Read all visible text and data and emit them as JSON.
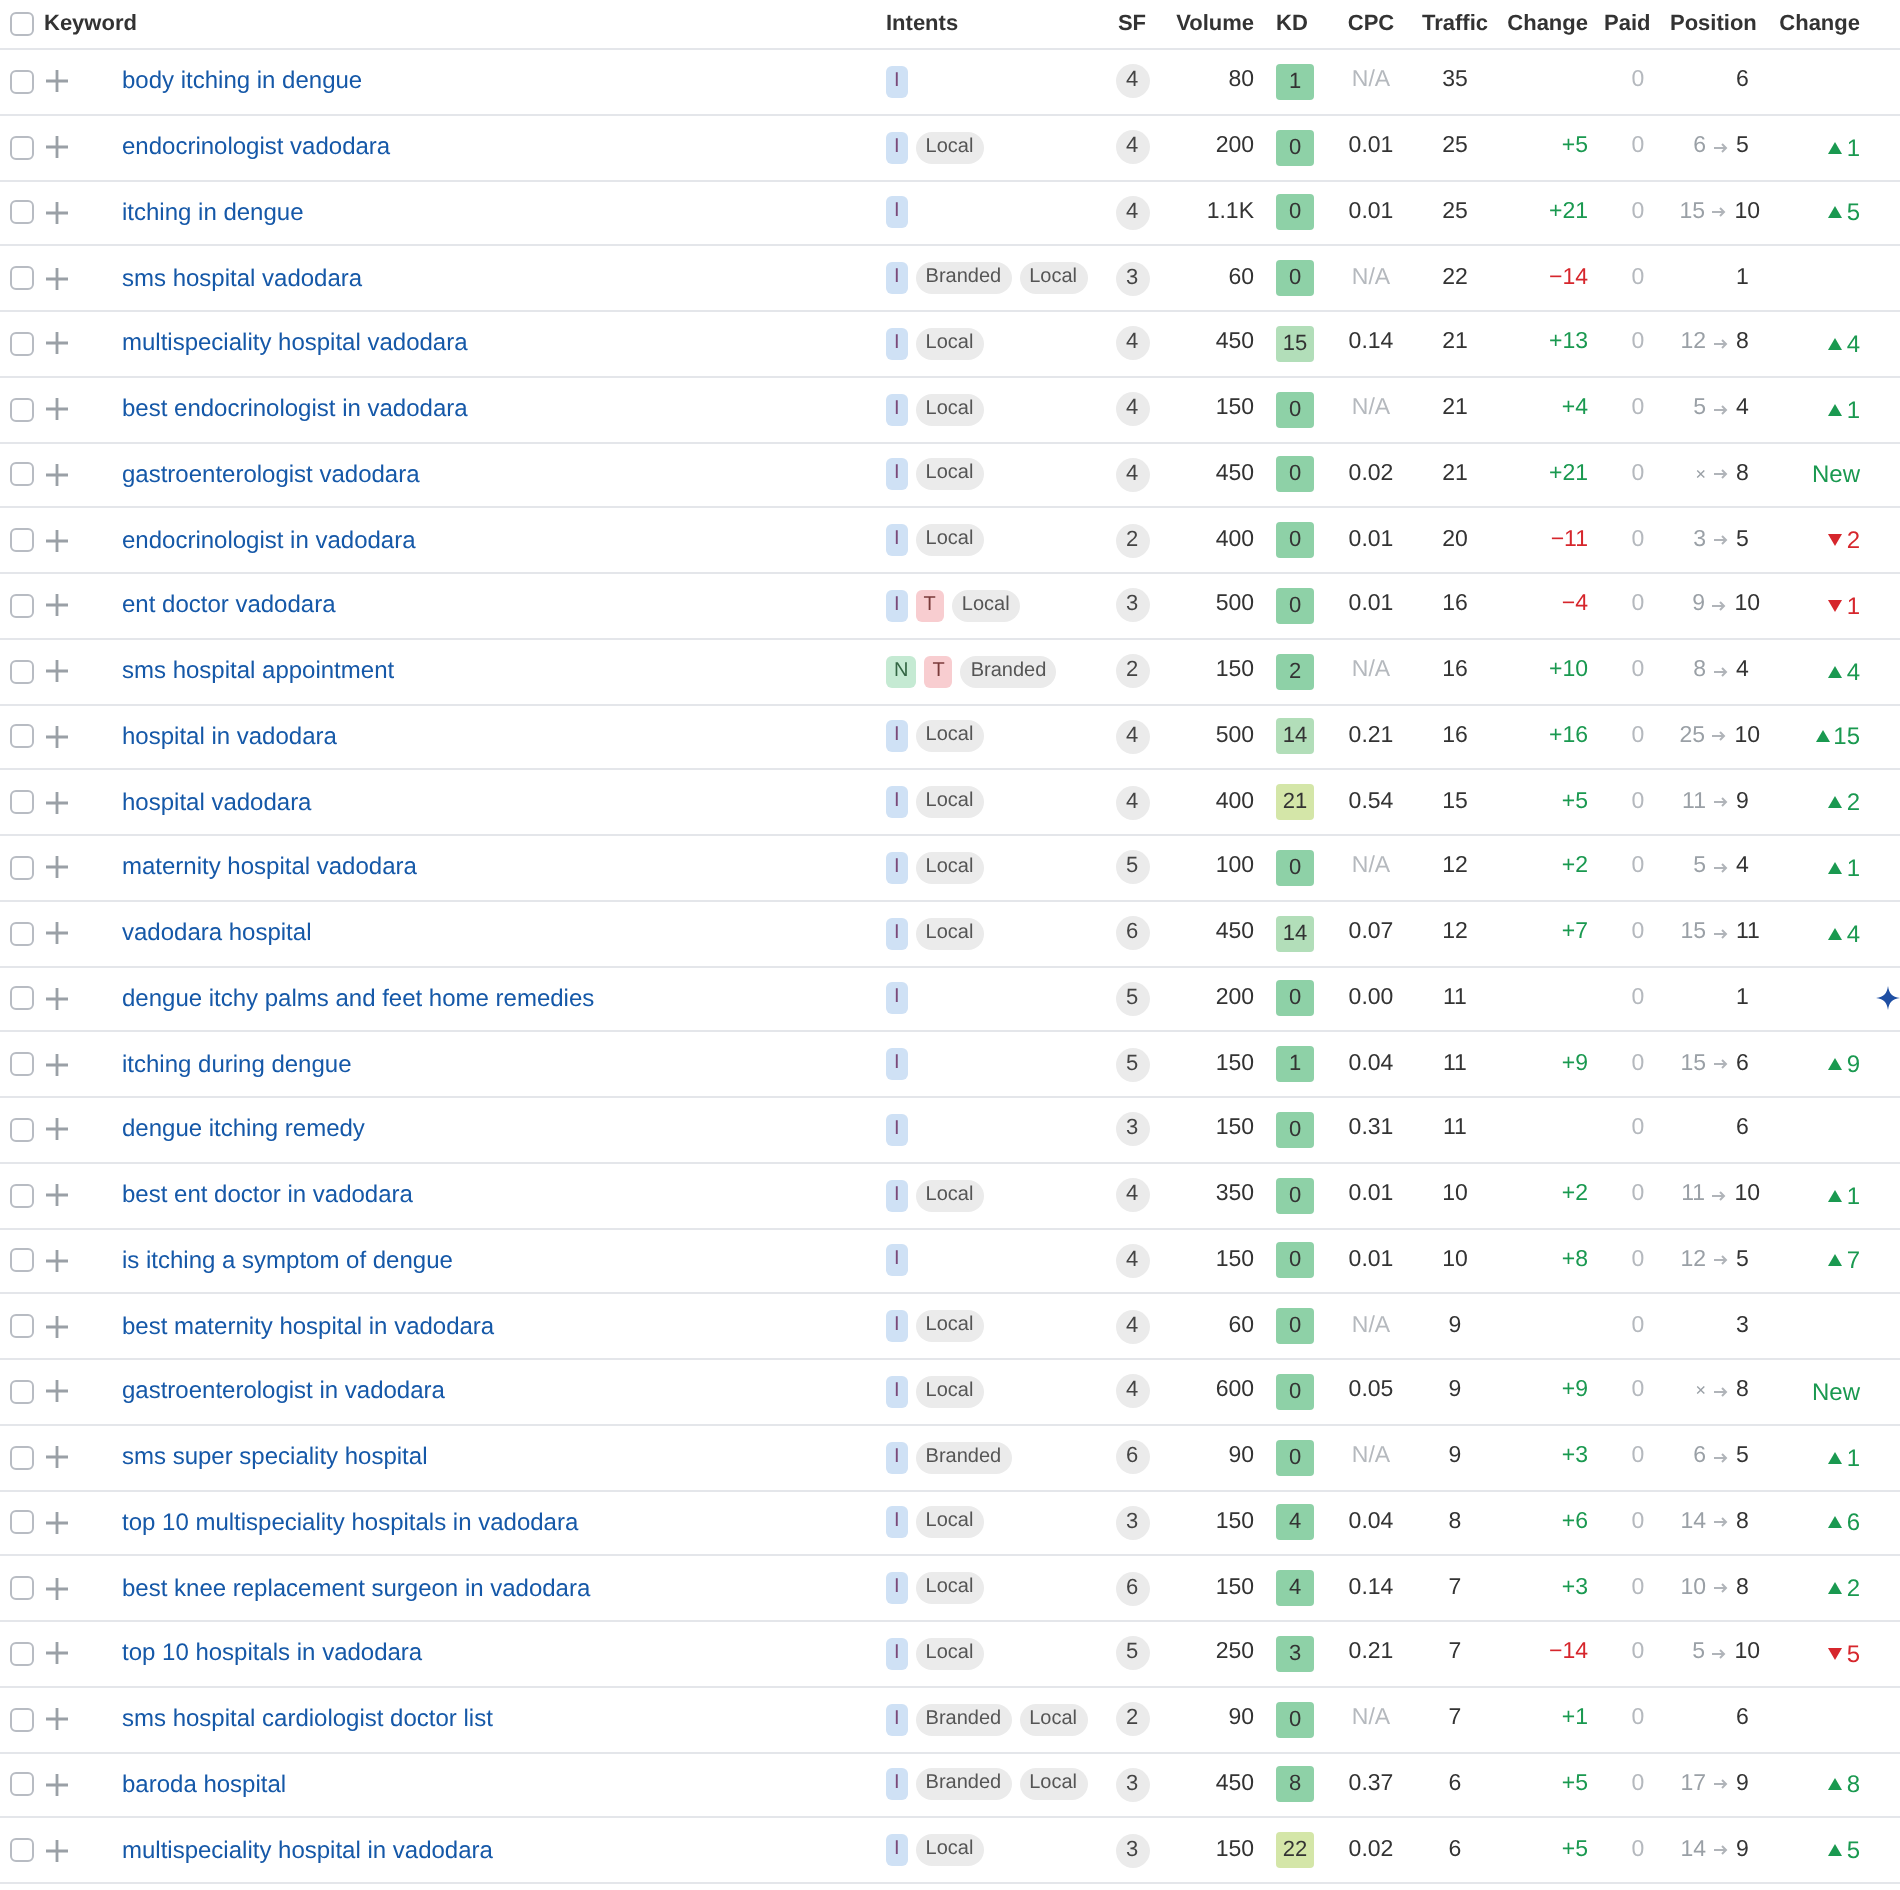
{
  "table": {
    "columns": [
      "Keyword",
      "Intents",
      "SF",
      "Volume",
      "KD",
      "CPC",
      "Traffic",
      "Change",
      "Paid",
      "Position",
      "Change"
    ],
    "all_selected": false,
    "rows": [
      {
        "keyword": "body itching in dengue",
        "selected": false,
        "intents": [
          {
            "label": "I",
            "kind": "informational"
          }
        ],
        "sf": "4",
        "volume": "80",
        "kd": {
          "value": "1",
          "color": "#8ed1a7"
        },
        "cpc": {
          "text": "N/A",
          "muted": true
        },
        "traffic": "35",
        "paid": "0",
        "position": {
          "to": "6"
        }
      },
      {
        "keyword": "endocrinologist vadodara",
        "selected": false,
        "intents": [
          {
            "label": "I",
            "kind": "informational"
          },
          {
            "label": "Local",
            "kind": "tag"
          }
        ],
        "sf": "4",
        "volume": "200",
        "kd": {
          "value": "0",
          "color": "#8ed1a7"
        },
        "cpc": {
          "text": "0.01",
          "muted": false
        },
        "traffic": "25",
        "traffic_change": {
          "text": "+5",
          "kind": "up"
        },
        "paid": "0",
        "position": {
          "from": "6",
          "to": "5"
        },
        "position_change": {
          "text": "1",
          "kind": "up"
        }
      },
      {
        "keyword": "itching in dengue",
        "selected": false,
        "intents": [
          {
            "label": "I",
            "kind": "informational"
          }
        ],
        "sf": "4",
        "volume": "1.1K",
        "kd": {
          "value": "0",
          "color": "#8ed1a7"
        },
        "cpc": {
          "text": "0.01",
          "muted": false
        },
        "traffic": "25",
        "traffic_change": {
          "text": "+21",
          "kind": "up"
        },
        "paid": "0",
        "position": {
          "from": "15",
          "to": "10"
        },
        "position_change": {
          "text": "5",
          "kind": "up"
        }
      },
      {
        "keyword": "sms hospital vadodara",
        "selected": false,
        "intents": [
          {
            "label": "I",
            "kind": "informational"
          },
          {
            "label": "Branded",
            "kind": "tag"
          },
          {
            "label": "Local",
            "kind": "tag"
          }
        ],
        "sf": "3",
        "volume": "60",
        "kd": {
          "value": "0",
          "color": "#8ed1a7"
        },
        "cpc": {
          "text": "N/A",
          "muted": true
        },
        "traffic": "22",
        "traffic_change": {
          "text": "−14",
          "kind": "down"
        },
        "paid": "0",
        "position": {
          "to": "1"
        }
      },
      {
        "keyword": "multispeciality hospital vadodara",
        "selected": false,
        "intents": [
          {
            "label": "I",
            "kind": "informational"
          },
          {
            "label": "Local",
            "kind": "tag"
          }
        ],
        "sf": "4",
        "volume": "450",
        "kd": {
          "value": "15",
          "color": "#b2deb9"
        },
        "cpc": {
          "text": "0.14",
          "muted": false
        },
        "traffic": "21",
        "traffic_change": {
          "text": "+13",
          "kind": "up"
        },
        "paid": "0",
        "position": {
          "from": "12",
          "to": "8"
        },
        "position_change": {
          "text": "4",
          "kind": "up"
        }
      },
      {
        "keyword": "best endocrinologist in vadodara",
        "selected": false,
        "intents": [
          {
            "label": "I",
            "kind": "informational"
          },
          {
            "label": "Local",
            "kind": "tag"
          }
        ],
        "sf": "4",
        "volume": "150",
        "kd": {
          "value": "0",
          "color": "#8ed1a7"
        },
        "cpc": {
          "text": "N/A",
          "muted": true
        },
        "traffic": "21",
        "traffic_change": {
          "text": "+4",
          "kind": "up"
        },
        "paid": "0",
        "position": {
          "from": "5",
          "to": "4"
        },
        "position_change": {
          "text": "1",
          "kind": "up"
        }
      },
      {
        "keyword": "gastroenterologist vadodara",
        "selected": false,
        "intents": [
          {
            "label": "I",
            "kind": "informational"
          },
          {
            "label": "Local",
            "kind": "tag"
          }
        ],
        "sf": "4",
        "volume": "450",
        "kd": {
          "value": "0",
          "color": "#8ed1a7"
        },
        "cpc": {
          "text": "0.02",
          "muted": false
        },
        "traffic": "21",
        "traffic_change": {
          "text": "+21",
          "kind": "up"
        },
        "paid": "0",
        "position": {
          "from": "×",
          "to": "8"
        },
        "position_change": {
          "text": "New",
          "kind": "new"
        }
      },
      {
        "keyword": "endocrinologist in vadodara",
        "selected": false,
        "intents": [
          {
            "label": "I",
            "kind": "informational"
          },
          {
            "label": "Local",
            "kind": "tag"
          }
        ],
        "sf": "2",
        "volume": "400",
        "kd": {
          "value": "0",
          "color": "#8ed1a7"
        },
        "cpc": {
          "text": "0.01",
          "muted": false
        },
        "traffic": "20",
        "traffic_change": {
          "text": "−11",
          "kind": "down"
        },
        "paid": "0",
        "position": {
          "from": "3",
          "to": "5"
        },
        "position_change": {
          "text": "2",
          "kind": "down"
        }
      },
      {
        "keyword": "ent doctor vadodara",
        "selected": false,
        "intents": [
          {
            "label": "I",
            "kind": "informational"
          },
          {
            "label": "T",
            "kind": "transactional"
          },
          {
            "label": "Local",
            "kind": "tag"
          }
        ],
        "sf": "3",
        "volume": "500",
        "kd": {
          "value": "0",
          "color": "#8ed1a7"
        },
        "cpc": {
          "text": "0.01",
          "muted": false
        },
        "traffic": "16",
        "traffic_change": {
          "text": "−4",
          "kind": "down"
        },
        "paid": "0",
        "position": {
          "from": "9",
          "to": "10"
        },
        "position_change": {
          "text": "1",
          "kind": "down"
        }
      },
      {
        "keyword": "sms hospital appointment",
        "selected": false,
        "intents": [
          {
            "label": "N",
            "kind": "navigational"
          },
          {
            "label": "T",
            "kind": "transactional"
          },
          {
            "label": "Branded",
            "kind": "tag"
          }
        ],
        "sf": "2",
        "volume": "150",
        "kd": {
          "value": "2",
          "color": "#8ed1a7"
        },
        "cpc": {
          "text": "N/A",
          "muted": true
        },
        "traffic": "16",
        "traffic_change": {
          "text": "+10",
          "kind": "up"
        },
        "paid": "0",
        "position": {
          "from": "8",
          "to": "4"
        },
        "position_change": {
          "text": "4",
          "kind": "up"
        }
      },
      {
        "keyword": "hospital in vadodara",
        "selected": false,
        "intents": [
          {
            "label": "I",
            "kind": "informational"
          },
          {
            "label": "Local",
            "kind": "tag"
          }
        ],
        "sf": "4",
        "volume": "500",
        "kd": {
          "value": "14",
          "color": "#b2deb9"
        },
        "cpc": {
          "text": "0.21",
          "muted": false
        },
        "traffic": "16",
        "traffic_change": {
          "text": "+16",
          "kind": "up"
        },
        "paid": "0",
        "position": {
          "from": "25",
          "to": "10"
        },
        "position_change": {
          "text": "15",
          "kind": "up"
        }
      },
      {
        "keyword": "hospital vadodara",
        "selected": false,
        "intents": [
          {
            "label": "I",
            "kind": "informational"
          },
          {
            "label": "Local",
            "kind": "tag"
          }
        ],
        "sf": "4",
        "volume": "400",
        "kd": {
          "value": "21",
          "color": "#d4e6a8"
        },
        "cpc": {
          "text": "0.54",
          "muted": false
        },
        "traffic": "15",
        "traffic_change": {
          "text": "+5",
          "kind": "up"
        },
        "paid": "0",
        "position": {
          "from": "11",
          "to": "9"
        },
        "position_change": {
          "text": "2",
          "kind": "up"
        }
      },
      {
        "keyword": "maternity hospital vadodara",
        "selected": false,
        "intents": [
          {
            "label": "I",
            "kind": "informational"
          },
          {
            "label": "Local",
            "kind": "tag"
          }
        ],
        "sf": "5",
        "volume": "100",
        "kd": {
          "value": "0",
          "color": "#8ed1a7"
        },
        "cpc": {
          "text": "N/A",
          "muted": true
        },
        "traffic": "12",
        "traffic_change": {
          "text": "+2",
          "kind": "up"
        },
        "paid": "0",
        "position": {
          "from": "5",
          "to": "4"
        },
        "position_change": {
          "text": "1",
          "kind": "up"
        }
      },
      {
        "keyword": "vadodara hospital",
        "selected": false,
        "intents": [
          {
            "label": "I",
            "kind": "informational"
          },
          {
            "label": "Local",
            "kind": "tag"
          }
        ],
        "sf": "6",
        "volume": "450",
        "kd": {
          "value": "14",
          "color": "#b2deb9"
        },
        "cpc": {
          "text": "0.07",
          "muted": false
        },
        "traffic": "12",
        "traffic_change": {
          "text": "+7",
          "kind": "up"
        },
        "paid": "0",
        "position": {
          "from": "15",
          "to": "11"
        },
        "position_change": {
          "text": "4",
          "kind": "up"
        }
      },
      {
        "keyword": "dengue itchy palms and feet home remedies",
        "selected": false,
        "intents": [
          {
            "label": "I",
            "kind": "informational"
          }
        ],
        "sf": "5",
        "volume": "200",
        "kd": {
          "value": "0",
          "color": "#8ed1a7"
        },
        "cpc": {
          "text": "0.00",
          "muted": false
        },
        "traffic": "11",
        "paid": "0",
        "position": {
          "to": "1"
        },
        "feature": true
      },
      {
        "keyword": "itching during dengue",
        "selected": false,
        "intents": [
          {
            "label": "I",
            "kind": "informational"
          }
        ],
        "sf": "5",
        "volume": "150",
        "kd": {
          "value": "1",
          "color": "#8ed1a7"
        },
        "cpc": {
          "text": "0.04",
          "muted": false
        },
        "traffic": "11",
        "traffic_change": {
          "text": "+9",
          "kind": "up"
        },
        "paid": "0",
        "position": {
          "from": "15",
          "to": "6"
        },
        "position_change": {
          "text": "9",
          "kind": "up"
        }
      },
      {
        "keyword": "dengue itching remedy",
        "selected": false,
        "intents": [
          {
            "label": "I",
            "kind": "informational"
          }
        ],
        "sf": "3",
        "volume": "150",
        "kd": {
          "value": "0",
          "color": "#8ed1a7"
        },
        "cpc": {
          "text": "0.31",
          "muted": false
        },
        "traffic": "11",
        "paid": "0",
        "position": {
          "to": "6"
        }
      },
      {
        "keyword": "best ent doctor in vadodara",
        "selected": false,
        "intents": [
          {
            "label": "I",
            "kind": "informational"
          },
          {
            "label": "Local",
            "kind": "tag"
          }
        ],
        "sf": "4",
        "volume": "350",
        "kd": {
          "value": "0",
          "color": "#8ed1a7"
        },
        "cpc": {
          "text": "0.01",
          "muted": false
        },
        "traffic": "10",
        "traffic_change": {
          "text": "+2",
          "kind": "up"
        },
        "paid": "0",
        "position": {
          "from": "11",
          "to": "10"
        },
        "position_change": {
          "text": "1",
          "kind": "up"
        }
      },
      {
        "keyword": "is itching a symptom of dengue",
        "selected": false,
        "intents": [
          {
            "label": "I",
            "kind": "informational"
          }
        ],
        "sf": "4",
        "volume": "150",
        "kd": {
          "value": "0",
          "color": "#8ed1a7"
        },
        "cpc": {
          "text": "0.01",
          "muted": false
        },
        "traffic": "10",
        "traffic_change": {
          "text": "+8",
          "kind": "up"
        },
        "paid": "0",
        "position": {
          "from": "12",
          "to": "5"
        },
        "position_change": {
          "text": "7",
          "kind": "up"
        }
      },
      {
        "keyword": "best maternity hospital in vadodara",
        "selected": false,
        "intents": [
          {
            "label": "I",
            "kind": "informational"
          },
          {
            "label": "Local",
            "kind": "tag"
          }
        ],
        "sf": "4",
        "volume": "60",
        "kd": {
          "value": "0",
          "color": "#8ed1a7"
        },
        "cpc": {
          "text": "N/A",
          "muted": true
        },
        "traffic": "9",
        "paid": "0",
        "position": {
          "to": "3"
        }
      },
      {
        "keyword": "gastroenterologist in vadodara",
        "selected": false,
        "intents": [
          {
            "label": "I",
            "kind": "informational"
          },
          {
            "label": "Local",
            "kind": "tag"
          }
        ],
        "sf": "4",
        "volume": "600",
        "kd": {
          "value": "0",
          "color": "#8ed1a7"
        },
        "cpc": {
          "text": "0.05",
          "muted": false
        },
        "traffic": "9",
        "traffic_change": {
          "text": "+9",
          "kind": "up"
        },
        "paid": "0",
        "position": {
          "from": "×",
          "to": "8"
        },
        "position_change": {
          "text": "New",
          "kind": "new"
        }
      },
      {
        "keyword": "sms super speciality hospital",
        "selected": false,
        "intents": [
          {
            "label": "I",
            "kind": "informational"
          },
          {
            "label": "Branded",
            "kind": "tag"
          }
        ],
        "sf": "6",
        "volume": "90",
        "kd": {
          "value": "0",
          "color": "#8ed1a7"
        },
        "cpc": {
          "text": "N/A",
          "muted": true
        },
        "traffic": "9",
        "traffic_change": {
          "text": "+3",
          "kind": "up"
        },
        "paid": "0",
        "position": {
          "from": "6",
          "to": "5"
        },
        "position_change": {
          "text": "1",
          "kind": "up"
        }
      },
      {
        "keyword": "top 10 multispeciality hospitals in vadodara",
        "selected": false,
        "intents": [
          {
            "label": "I",
            "kind": "informational"
          },
          {
            "label": "Local",
            "kind": "tag"
          }
        ],
        "sf": "3",
        "volume": "150",
        "kd": {
          "value": "4",
          "color": "#8ed1a7"
        },
        "cpc": {
          "text": "0.04",
          "muted": false
        },
        "traffic": "8",
        "traffic_change": {
          "text": "+6",
          "kind": "up"
        },
        "paid": "0",
        "position": {
          "from": "14",
          "to": "8"
        },
        "position_change": {
          "text": "6",
          "kind": "up"
        }
      },
      {
        "keyword": "best knee replacement surgeon in vadodara",
        "selected": false,
        "intents": [
          {
            "label": "I",
            "kind": "informational"
          },
          {
            "label": "Local",
            "kind": "tag"
          }
        ],
        "sf": "6",
        "volume": "150",
        "kd": {
          "value": "4",
          "color": "#8ed1a7"
        },
        "cpc": {
          "text": "0.14",
          "muted": false
        },
        "traffic": "7",
        "traffic_change": {
          "text": "+3",
          "kind": "up"
        },
        "paid": "0",
        "position": {
          "from": "10",
          "to": "8"
        },
        "position_change": {
          "text": "2",
          "kind": "up"
        }
      },
      {
        "keyword": "top 10 hospitals in vadodara",
        "selected": false,
        "intents": [
          {
            "label": "I",
            "kind": "informational"
          },
          {
            "label": "Local",
            "kind": "tag"
          }
        ],
        "sf": "5",
        "volume": "250",
        "kd": {
          "value": "3",
          "color": "#8ed1a7"
        },
        "cpc": {
          "text": "0.21",
          "muted": false
        },
        "traffic": "7",
        "traffic_change": {
          "text": "−14",
          "kind": "down"
        },
        "paid": "0",
        "position": {
          "from": "5",
          "to": "10"
        },
        "position_change": {
          "text": "5",
          "kind": "down"
        }
      },
      {
        "keyword": "sms hospital cardiologist doctor list",
        "selected": false,
        "intents": [
          {
            "label": "I",
            "kind": "informational"
          },
          {
            "label": "Branded",
            "kind": "tag"
          },
          {
            "label": "Local",
            "kind": "tag"
          }
        ],
        "sf": "2",
        "volume": "90",
        "kd": {
          "value": "0",
          "color": "#8ed1a7"
        },
        "cpc": {
          "text": "N/A",
          "muted": true
        },
        "traffic": "7",
        "traffic_change": {
          "text": "+1",
          "kind": "up"
        },
        "paid": "0",
        "position": {
          "to": "6"
        }
      },
      {
        "keyword": "baroda hospital",
        "selected": false,
        "intents": [
          {
            "label": "I",
            "kind": "informational"
          },
          {
            "label": "Branded",
            "kind": "tag"
          },
          {
            "label": "Local",
            "kind": "tag"
          }
        ],
        "sf": "3",
        "volume": "450",
        "kd": {
          "value": "8",
          "color": "#8ed1a7"
        },
        "cpc": {
          "text": "0.37",
          "muted": false
        },
        "traffic": "6",
        "traffic_change": {
          "text": "+5",
          "kind": "up"
        },
        "paid": "0",
        "position": {
          "from": "17",
          "to": "9"
        },
        "position_change": {
          "text": "8",
          "kind": "up"
        }
      },
      {
        "keyword": "multispeciality hospital in vadodara",
        "selected": false,
        "intents": [
          {
            "label": "I",
            "kind": "informational"
          },
          {
            "label": "Local",
            "kind": "tag"
          }
        ],
        "sf": "3",
        "volume": "150",
        "kd": {
          "value": "22",
          "color": "#d4e6a8"
        },
        "cpc": {
          "text": "0.02",
          "muted": false
        },
        "traffic": "6",
        "traffic_change": {
          "text": "+5",
          "kind": "up"
        },
        "paid": "0",
        "position": {
          "from": "14",
          "to": "9"
        },
        "position_change": {
          "text": "5",
          "kind": "up"
        }
      }
    ]
  }
}
